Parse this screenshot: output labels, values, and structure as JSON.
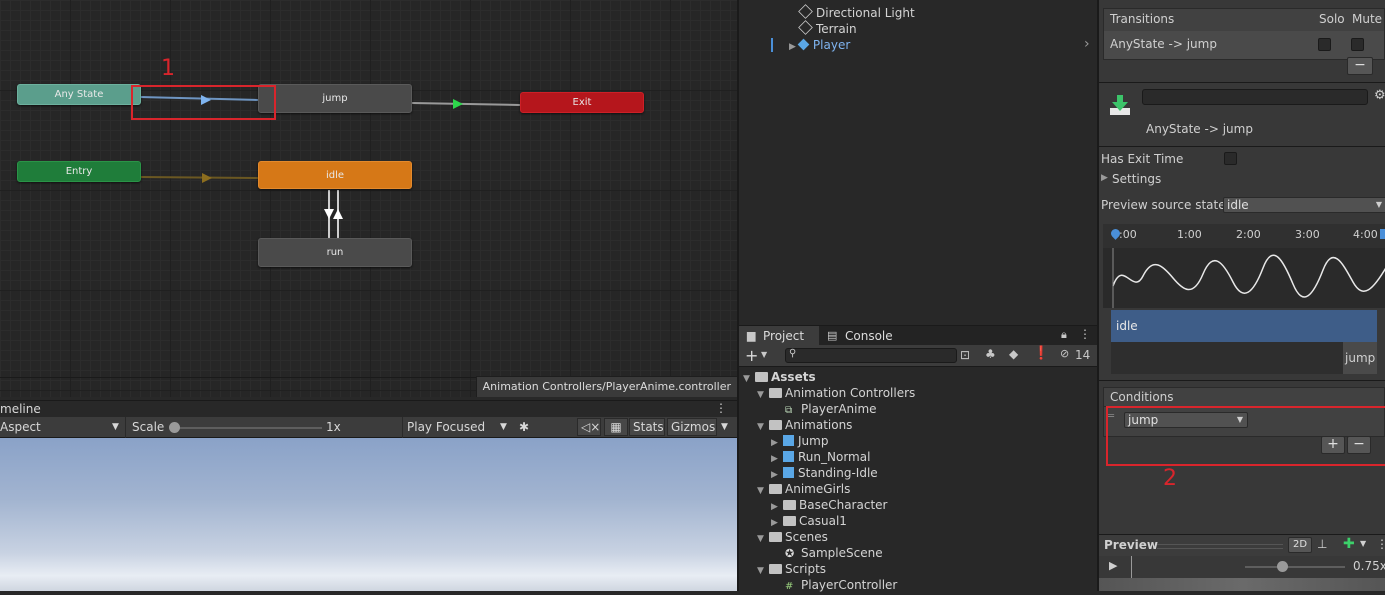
{
  "animator": {
    "states": {
      "any_state": "Any State",
      "jump": "jump",
      "exit": "Exit",
      "entry": "Entry",
      "idle": "idle",
      "run": "run"
    },
    "path": "Animation Controllers/PlayerAnime.controller",
    "annotation_1": "1"
  },
  "game": {
    "tab_label": "meline",
    "aspect": "Aspect",
    "scale_label": "Scale",
    "scale_value": "1x",
    "play_mode": "Play Focused",
    "stats": "Stats",
    "gizmos": "Gizmos"
  },
  "hierarchy": {
    "items": [
      "Directional Light",
      "Terrain",
      "Player"
    ]
  },
  "project": {
    "tabs": [
      "Project",
      "Console"
    ],
    "hidden_count": "14",
    "tree": [
      {
        "label": "Assets",
        "type": "folder",
        "bold": true
      },
      {
        "label": "Animation Controllers",
        "type": "folder"
      },
      {
        "label": "PlayerAnime",
        "type": "controller"
      },
      {
        "label": "Animations",
        "type": "folder"
      },
      {
        "label": "Jump",
        "type": "model"
      },
      {
        "label": "Run_Normal",
        "type": "model"
      },
      {
        "label": "Standing-Idle",
        "type": "model"
      },
      {
        "label": "AnimeGirls",
        "type": "folder"
      },
      {
        "label": "BaseCharacter",
        "type": "folder"
      },
      {
        "label": "Casual1",
        "type": "folder"
      },
      {
        "label": "Scenes",
        "type": "folder"
      },
      {
        "label": "SampleScene",
        "type": "scene"
      },
      {
        "label": "Scripts",
        "type": "folder"
      },
      {
        "label": "PlayerController",
        "type": "script"
      }
    ]
  },
  "inspector": {
    "transitions_header": "Transitions",
    "solo": "Solo",
    "mute": "Mute",
    "transition_item": "AnyState -> jump",
    "minus": "−",
    "transition_title": "AnyState -> jump",
    "has_exit_time": "Has Exit Time",
    "settings": "Settings",
    "preview_source_label": "Preview source state",
    "preview_source_value": "idle",
    "timeline_ticks": [
      ":00",
      "1:00",
      "2:00",
      "3:00",
      "4:00"
    ],
    "track_idle": "idle",
    "track_jump": "jump",
    "conditions_header": "Conditions",
    "condition_param": "jump",
    "plus": "+",
    "annotation_2": "2",
    "preview_label": "Preview",
    "preview_2d": "2D",
    "speed": "0.75x"
  },
  "colors": {
    "annotation_red": "#d9252c",
    "state_orange": "#d67817",
    "state_red": "#b5161c",
    "state_green": "#1f7d3a",
    "state_teal": "#5b9e8c",
    "selected_blue": "#7fb4f0"
  }
}
